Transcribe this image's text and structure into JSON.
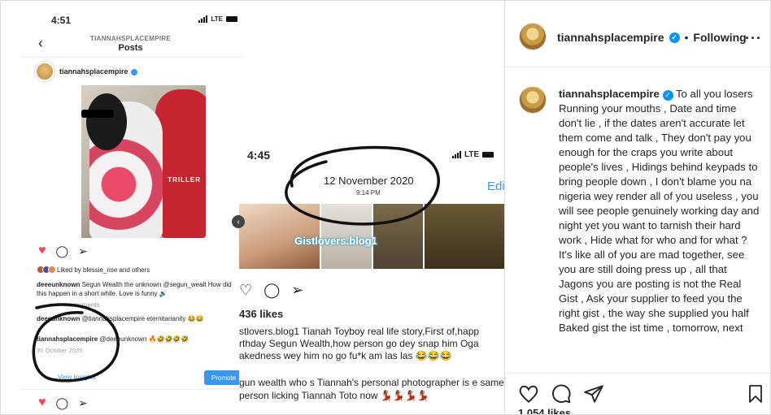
{
  "screenshot_a": {
    "time": "4:51",
    "network": "LTE",
    "header_sub": "TIANNAHSPLACEMPIRE",
    "header_title": "Posts",
    "username": "tiannahsplacempire",
    "photo_watermark": "TRILLER",
    "liked_by": "Liked by blessie_rise and others",
    "caption_user": "deeeunknown",
    "caption": "Segun Wealth the unknown @segun_wealt How did this happen in a short while. Love is funny 🔊",
    "view_all": "...comments",
    "comment1_user": "deeeunknown",
    "comment1": "@tiannahsplacempire eternitarianity 😂😂",
    "comment2_user": "tiannahsplacempire",
    "comment2": "@deeeunknown 🔥🤣🤣🤣🤣",
    "date": "30 October 2020",
    "insights": "View Insights",
    "promote": "Promote"
  },
  "screenshot_b": {
    "time": "4:45",
    "network": "LTE",
    "date": "12 November 2020",
    "time_posted": "9:14 PM",
    "edit_partial": "Edi",
    "watermark": "Gistlovers.blog1",
    "likes": "436 likes",
    "caption": "stlovers.blog1 Tianah Toyboy real life story,First of,happ rthday Segun Wealth,how person go dey snap him Oga akedness wey him no go fu*k am las las 😂😂😂",
    "caption2": "gun wealth who s Tiannah's personal photographer is e same person licking Tiannah Toto now 💃🏾💃🏾💃🏾💃🏾"
  },
  "panel": {
    "username": "tiannahsplacempire",
    "follow_status": "Following",
    "caption_user": "tiannahsplacempire",
    "caption": "To all you losers Running your mouths , Date and time don't lie , if the dates aren't accurate let them come and talk , They don't pay you enough for the craps you write about people's lives , Hidings behind keypads to bring people down , I don't blame you na nigeria wey render all of you useless , you will see people genuinely working day and night yet you want to tarnish their hard work , Hide what for who and for what ? It's like all of you are mad together, see you are still doing press up , all that Jagons you are posting is not the Real Gist , Ask your supplier to feed you the right gist , the way she supplied you half Baked gist the ist time , tomorrow, next",
    "likes_partial": "1,054 likes",
    "icons": [
      "heart-icon",
      "comment-icon",
      "share-icon",
      "bookmark-icon",
      "more-icon"
    ]
  }
}
